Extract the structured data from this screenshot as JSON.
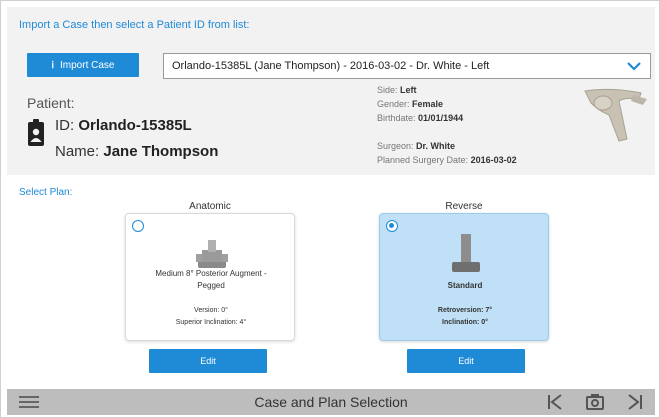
{
  "header": {
    "import_title": "Import a Case then select a Patient ID from list:",
    "import_button_label": "Import Case",
    "case_selected": "Orlando-15385L (Jane Thompson) - 2016-03-02 - Dr. White - Left"
  },
  "patient": {
    "label": "Patient:",
    "id_prefix": "ID:",
    "id": "Orlando-15385L",
    "name_prefix": "Name:",
    "name": "Jane Thompson",
    "side_label": "Side:",
    "side": "Left",
    "gender_label": "Gender:",
    "gender": "Female",
    "birthdate_label": "Birthdate:",
    "birthdate": "01/01/1944",
    "surgeon_label": "Surgeon:",
    "surgeon": "Dr. White",
    "surgery_date_label": "Planned Surgery Date:",
    "surgery_date": "2016-03-02"
  },
  "plans": {
    "label": "Select Plan:",
    "anatomic": {
      "title": "Anatomic",
      "name_line1": "Medium 8° Posterior Augment -",
      "name_line2": "Pegged",
      "version": "Version: 0°",
      "inclination": "Superior Inclination: 4°",
      "edit_label": "Edit",
      "selected": false
    },
    "reverse": {
      "title": "Reverse",
      "name": "Standard",
      "retroversion": "Retroversion: 7°",
      "inclination": "Inclination: 0°",
      "edit_label": "Edit",
      "selected": true
    }
  },
  "footer": {
    "title": "Case and Plan Selection",
    "icons": [
      "menu-icon",
      "first-page-icon",
      "camera-icon",
      "next-page-icon"
    ]
  },
  "colors": {
    "accent": "#1f8ad6",
    "selected_card": "#bfe0f7",
    "header_bg": "#f2f2f2",
    "footer_bg": "#bdbdbd"
  }
}
